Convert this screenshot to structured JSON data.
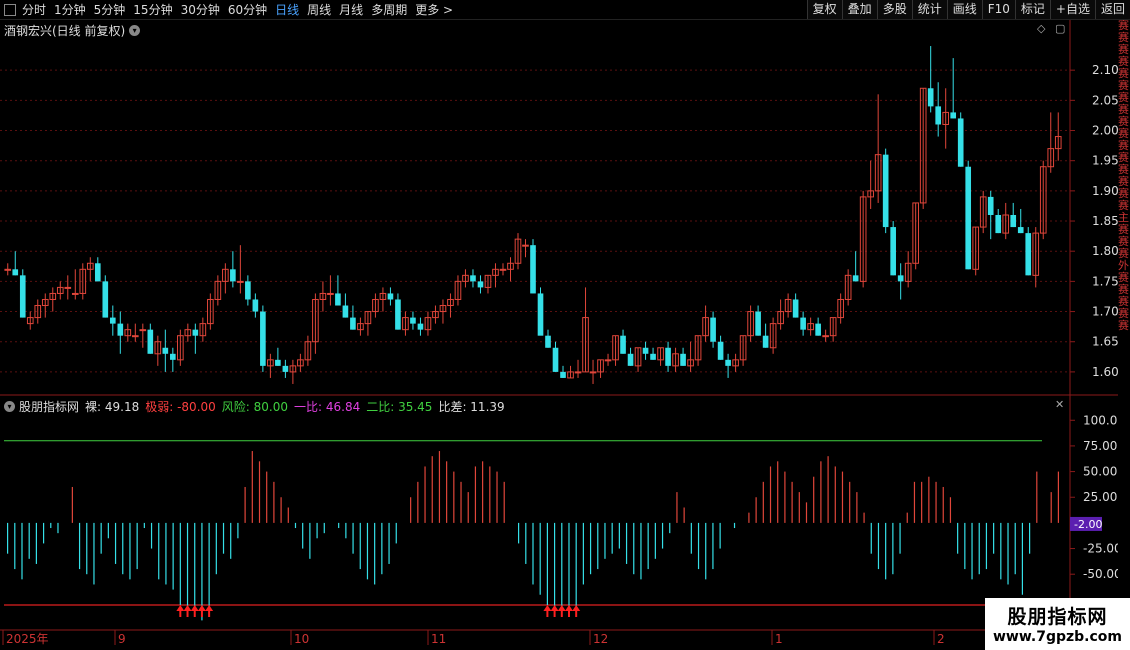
{
  "toolbar": {
    "periods": [
      "分时",
      "1分钟",
      "5分钟",
      "15分钟",
      "30分钟",
      "60分钟",
      "日线",
      "周线",
      "月线",
      "多周期",
      "更多 >"
    ],
    "active_period": "日线",
    "actions": [
      "复权",
      "叠加",
      "多股",
      "统计",
      "画线",
      "F10",
      "标记",
      "+自选",
      "返回"
    ]
  },
  "price_panel": {
    "title": "酒钢宏兴(日线 前复权)",
    "y_ticks": [
      "2.10",
      "2.05",
      "2.00",
      "1.95",
      "1.90",
      "1.85",
      "1.80",
      "1.75",
      "1.70",
      "1.65",
      "1.60"
    ]
  },
  "indicator_panel": {
    "name": "股朋指标网",
    "values": [
      {
        "label": "裸:",
        "value": "49.18",
        "color": "#dddddd"
      },
      {
        "label": "极弱:",
        "value": "-80.00",
        "color": "#ff4040"
      },
      {
        "label": "风险:",
        "value": "80.00",
        "color": "#40d040"
      },
      {
        "label": "一比:",
        "value": "46.84",
        "color": "#e040e0"
      },
      {
        "label": "二比:",
        "value": "35.45",
        "color": "#40d040"
      },
      {
        "label": "比差:",
        "value": "11.39",
        "color": "#dddddd"
      }
    ],
    "y_ticks": [
      "100.0",
      "75.00",
      "50.00",
      "25.00",
      "-25.00",
      "-50.00"
    ],
    "current_tag": "-2.00"
  },
  "date_axis": [
    "2025年",
    "9",
    "10",
    "11",
    "12",
    "1",
    "2"
  ],
  "right_strip_text": "赛赛赛赛赛赛赛赛赛赛赛赛赛赛赛赛主赛赛赛外赛赛赛赛赛",
  "watermark": {
    "title": "股朋指标网",
    "url": "www.7gpzb.com"
  },
  "colors": {
    "up": "#e0463a",
    "down": "#35e0e8",
    "grid": "#5a1010",
    "line_green": "#40d040",
    "line_red": "#e02020"
  },
  "chart_data": {
    "type": "candlestick",
    "series": [
      {
        "name": "candles",
        "ohlc": [
          [
            1.77,
            1.78,
            1.76,
            1.77
          ],
          [
            1.77,
            1.8,
            1.76,
            1.76
          ],
          [
            1.76,
            1.77,
            1.69,
            1.69
          ],
          [
            1.68,
            1.7,
            1.67,
            1.69
          ],
          [
            1.69,
            1.72,
            1.68,
            1.71
          ],
          [
            1.71,
            1.73,
            1.69,
            1.72
          ],
          [
            1.72,
            1.74,
            1.7,
            1.73
          ],
          [
            1.73,
            1.75,
            1.72,
            1.74
          ],
          [
            1.74,
            1.76,
            1.72,
            1.74
          ],
          [
            1.73,
            1.77,
            1.72,
            1.73
          ],
          [
            1.73,
            1.78,
            1.72,
            1.77
          ],
          [
            1.77,
            1.79,
            1.75,
            1.78
          ],
          [
            1.78,
            1.79,
            1.75,
            1.75
          ],
          [
            1.75,
            1.76,
            1.69,
            1.69
          ],
          [
            1.69,
            1.71,
            1.66,
            1.68
          ],
          [
            1.68,
            1.7,
            1.63,
            1.66
          ],
          [
            1.66,
            1.68,
            1.65,
            1.67
          ],
          [
            1.66,
            1.68,
            1.65,
            1.66
          ],
          [
            1.67,
            1.68,
            1.64,
            1.67
          ],
          [
            1.67,
            1.68,
            1.63,
            1.63
          ],
          [
            1.63,
            1.66,
            1.61,
            1.65
          ],
          [
            1.64,
            1.67,
            1.6,
            1.63
          ],
          [
            1.63,
            1.64,
            1.6,
            1.62
          ],
          [
            1.62,
            1.67,
            1.61,
            1.66
          ],
          [
            1.66,
            1.68,
            1.65,
            1.67
          ],
          [
            1.67,
            1.68,
            1.63,
            1.66
          ],
          [
            1.66,
            1.69,
            1.65,
            1.68
          ],
          [
            1.68,
            1.73,
            1.67,
            1.72
          ],
          [
            1.72,
            1.76,
            1.71,
            1.75
          ],
          [
            1.75,
            1.78,
            1.73,
            1.77
          ],
          [
            1.77,
            1.8,
            1.74,
            1.75
          ],
          [
            1.75,
            1.81,
            1.73,
            1.75
          ],
          [
            1.75,
            1.76,
            1.71,
            1.72
          ],
          [
            1.72,
            1.73,
            1.69,
            1.7
          ],
          [
            1.7,
            1.71,
            1.6,
            1.61
          ],
          [
            1.61,
            1.63,
            1.59,
            1.62
          ],
          [
            1.62,
            1.64,
            1.61,
            1.61
          ],
          [
            1.61,
            1.62,
            1.59,
            1.6
          ],
          [
            1.6,
            1.62,
            1.58,
            1.61
          ],
          [
            1.61,
            1.63,
            1.6,
            1.62
          ],
          [
            1.62,
            1.66,
            1.61,
            1.65
          ],
          [
            1.65,
            1.73,
            1.63,
            1.72
          ],
          [
            1.72,
            1.75,
            1.7,
            1.73
          ],
          [
            1.73,
            1.76,
            1.71,
            1.73
          ],
          [
            1.73,
            1.76,
            1.71,
            1.71
          ],
          [
            1.71,
            1.73,
            1.69,
            1.69
          ],
          [
            1.69,
            1.71,
            1.67,
            1.67
          ],
          [
            1.67,
            1.69,
            1.66,
            1.68
          ],
          [
            1.68,
            1.7,
            1.66,
            1.7
          ],
          [
            1.7,
            1.73,
            1.69,
            1.72
          ],
          [
            1.72,
            1.74,
            1.7,
            1.73
          ],
          [
            1.73,
            1.74,
            1.71,
            1.72
          ],
          [
            1.72,
            1.73,
            1.67,
            1.67
          ],
          [
            1.67,
            1.7,
            1.66,
            1.69
          ],
          [
            1.69,
            1.7,
            1.67,
            1.68
          ],
          [
            1.68,
            1.69,
            1.66,
            1.67
          ],
          [
            1.67,
            1.7,
            1.66,
            1.69
          ],
          [
            1.69,
            1.71,
            1.68,
            1.7
          ],
          [
            1.7,
            1.72,
            1.68,
            1.71
          ],
          [
            1.71,
            1.73,
            1.69,
            1.72
          ],
          [
            1.72,
            1.76,
            1.71,
            1.75
          ],
          [
            1.75,
            1.77,
            1.74,
            1.76
          ],
          [
            1.76,
            1.77,
            1.74,
            1.75
          ],
          [
            1.75,
            1.76,
            1.73,
            1.74
          ],
          [
            1.74,
            1.76,
            1.73,
            1.76
          ],
          [
            1.76,
            1.78,
            1.74,
            1.77
          ],
          [
            1.77,
            1.78,
            1.76,
            1.77
          ],
          [
            1.77,
            1.79,
            1.75,
            1.78
          ],
          [
            1.78,
            1.83,
            1.77,
            1.82
          ],
          [
            1.81,
            1.82,
            1.79,
            1.81
          ],
          [
            1.81,
            1.82,
            1.73,
            1.73
          ],
          [
            1.73,
            1.74,
            1.67,
            1.66
          ],
          [
            1.66,
            1.67,
            1.64,
            1.64
          ],
          [
            1.64,
            1.65,
            1.6,
            1.6
          ],
          [
            1.6,
            1.61,
            1.59,
            1.59
          ],
          [
            1.59,
            1.61,
            1.59,
            1.6
          ],
          [
            1.6,
            1.62,
            1.59,
            1.6
          ],
          [
            1.6,
            1.74,
            1.6,
            1.69
          ],
          [
            1.6,
            1.62,
            1.58,
            1.6
          ],
          [
            1.6,
            1.62,
            1.59,
            1.62
          ],
          [
            1.62,
            1.63,
            1.61,
            1.62
          ],
          [
            1.62,
            1.66,
            1.61,
            1.66
          ],
          [
            1.66,
            1.67,
            1.63,
            1.63
          ],
          [
            1.63,
            1.64,
            1.61,
            1.61
          ],
          [
            1.61,
            1.64,
            1.6,
            1.64
          ],
          [
            1.64,
            1.65,
            1.62,
            1.63
          ],
          [
            1.63,
            1.64,
            1.62,
            1.62
          ],
          [
            1.62,
            1.64,
            1.61,
            1.64
          ],
          [
            1.64,
            1.65,
            1.6,
            1.61
          ],
          [
            1.61,
            1.64,
            1.6,
            1.63
          ],
          [
            1.63,
            1.64,
            1.61,
            1.61
          ],
          [
            1.61,
            1.65,
            1.6,
            1.62
          ],
          [
            1.62,
            1.66,
            1.61,
            1.66
          ],
          [
            1.66,
            1.71,
            1.65,
            1.69
          ],
          [
            1.69,
            1.7,
            1.64,
            1.65
          ],
          [
            1.65,
            1.66,
            1.62,
            1.62
          ],
          [
            1.62,
            1.63,
            1.59,
            1.61
          ],
          [
            1.61,
            1.63,
            1.6,
            1.62
          ],
          [
            1.62,
            1.66,
            1.61,
            1.66
          ],
          [
            1.66,
            1.71,
            1.65,
            1.7
          ],
          [
            1.7,
            1.71,
            1.66,
            1.66
          ],
          [
            1.66,
            1.68,
            1.64,
            1.64
          ],
          [
            1.64,
            1.69,
            1.63,
            1.68
          ],
          [
            1.68,
            1.72,
            1.67,
            1.7
          ],
          [
            1.7,
            1.73,
            1.69,
            1.72
          ],
          [
            1.72,
            1.73,
            1.69,
            1.69
          ],
          [
            1.69,
            1.7,
            1.66,
            1.67
          ],
          [
            1.67,
            1.69,
            1.66,
            1.68
          ],
          [
            1.68,
            1.69,
            1.66,
            1.66
          ],
          [
            1.66,
            1.67,
            1.65,
            1.66
          ],
          [
            1.66,
            1.69,
            1.65,
            1.69
          ],
          [
            1.69,
            1.73,
            1.68,
            1.72
          ],
          [
            1.72,
            1.77,
            1.71,
            1.76
          ],
          [
            1.76,
            1.8,
            1.75,
            1.75
          ],
          [
            1.75,
            1.9,
            1.74,
            1.89
          ],
          [
            1.89,
            1.95,
            1.87,
            1.9
          ],
          [
            1.9,
            2.06,
            1.88,
            1.96
          ],
          [
            1.96,
            1.97,
            1.83,
            1.84
          ],
          [
            1.84,
            1.85,
            1.76,
            1.76
          ],
          [
            1.76,
            1.78,
            1.72,
            1.75
          ],
          [
            1.75,
            1.8,
            1.74,
            1.78
          ],
          [
            1.78,
            1.88,
            1.77,
            1.88
          ],
          [
            1.88,
            2.07,
            1.87,
            2.07
          ],
          [
            2.07,
            2.14,
            2.03,
            2.04
          ],
          [
            2.04,
            2.08,
            1.99,
            2.01
          ],
          [
            2.01,
            2.07,
            1.97,
            2.03
          ],
          [
            2.03,
            2.12,
            2.02,
            2.02
          ],
          [
            2.02,
            2.03,
            1.94,
            1.94
          ],
          [
            1.94,
            1.95,
            1.77,
            1.77
          ],
          [
            1.77,
            1.84,
            1.76,
            1.84
          ],
          [
            1.84,
            1.9,
            1.83,
            1.89
          ],
          [
            1.89,
            1.9,
            1.82,
            1.86
          ],
          [
            1.86,
            1.87,
            1.83,
            1.83
          ],
          [
            1.83,
            1.88,
            1.82,
            1.86
          ],
          [
            1.86,
            1.88,
            1.84,
            1.84
          ],
          [
            1.84,
            1.87,
            1.83,
            1.83
          ],
          [
            1.83,
            1.84,
            1.76,
            1.76
          ],
          [
            1.76,
            1.84,
            1.74,
            1.83
          ],
          [
            1.83,
            1.95,
            1.82,
            1.94
          ],
          [
            1.94,
            2.03,
            1.93,
            1.97
          ],
          [
            1.97,
            2.03,
            1.95,
            1.99
          ]
        ]
      }
    ],
    "oscillator": [
      -30,
      -45,
      -55,
      -35,
      -40,
      -20,
      -5,
      -10,
      0,
      35,
      -45,
      -50,
      -60,
      -30,
      -15,
      -40,
      -50,
      -55,
      -45,
      -5,
      -25,
      -55,
      -60,
      -65,
      -80,
      -85,
      -90,
      -95,
      -90,
      -50,
      -30,
      -35,
      -15,
      35,
      70,
      60,
      50,
      40,
      25,
      15,
      -5,
      -25,
      -35,
      -15,
      -10,
      0,
      -5,
      -15,
      -30,
      -45,
      -55,
      -60,
      -50,
      -40,
      -20,
      0,
      25,
      40,
      55,
      65,
      70,
      60,
      50,
      40,
      30,
      55,
      60,
      55,
      50,
      40,
      0,
      -20,
      -40,
      -60,
      -70,
      -80,
      -85,
      -90,
      -90,
      -85,
      -60,
      -50,
      -45,
      -35,
      -30,
      -25,
      -40,
      -50,
      -55,
      -45,
      -35,
      -25,
      -10,
      30,
      15,
      -30,
      -45,
      -55,
      -45,
      -25,
      0,
      -5,
      0,
      10,
      25,
      40,
      55,
      60,
      50,
      40,
      30,
      20,
      45,
      60,
      65,
      55,
      50,
      40,
      30,
      10,
      -30,
      -45,
      -55,
      -50,
      -30,
      10,
      40,
      40,
      45,
      40,
      35,
      25,
      -30,
      -45,
      -55,
      -50,
      -45,
      -30,
      -55,
      -60,
      -50,
      -70,
      -30,
      50,
      0,
      30,
      50
    ],
    "oscillator_lines": {
      "risk": 80,
      "weak": -80
    },
    "ylim_price": [
      1.57,
      2.15
    ],
    "ylim_ind": [
      -80,
      110
    ]
  }
}
